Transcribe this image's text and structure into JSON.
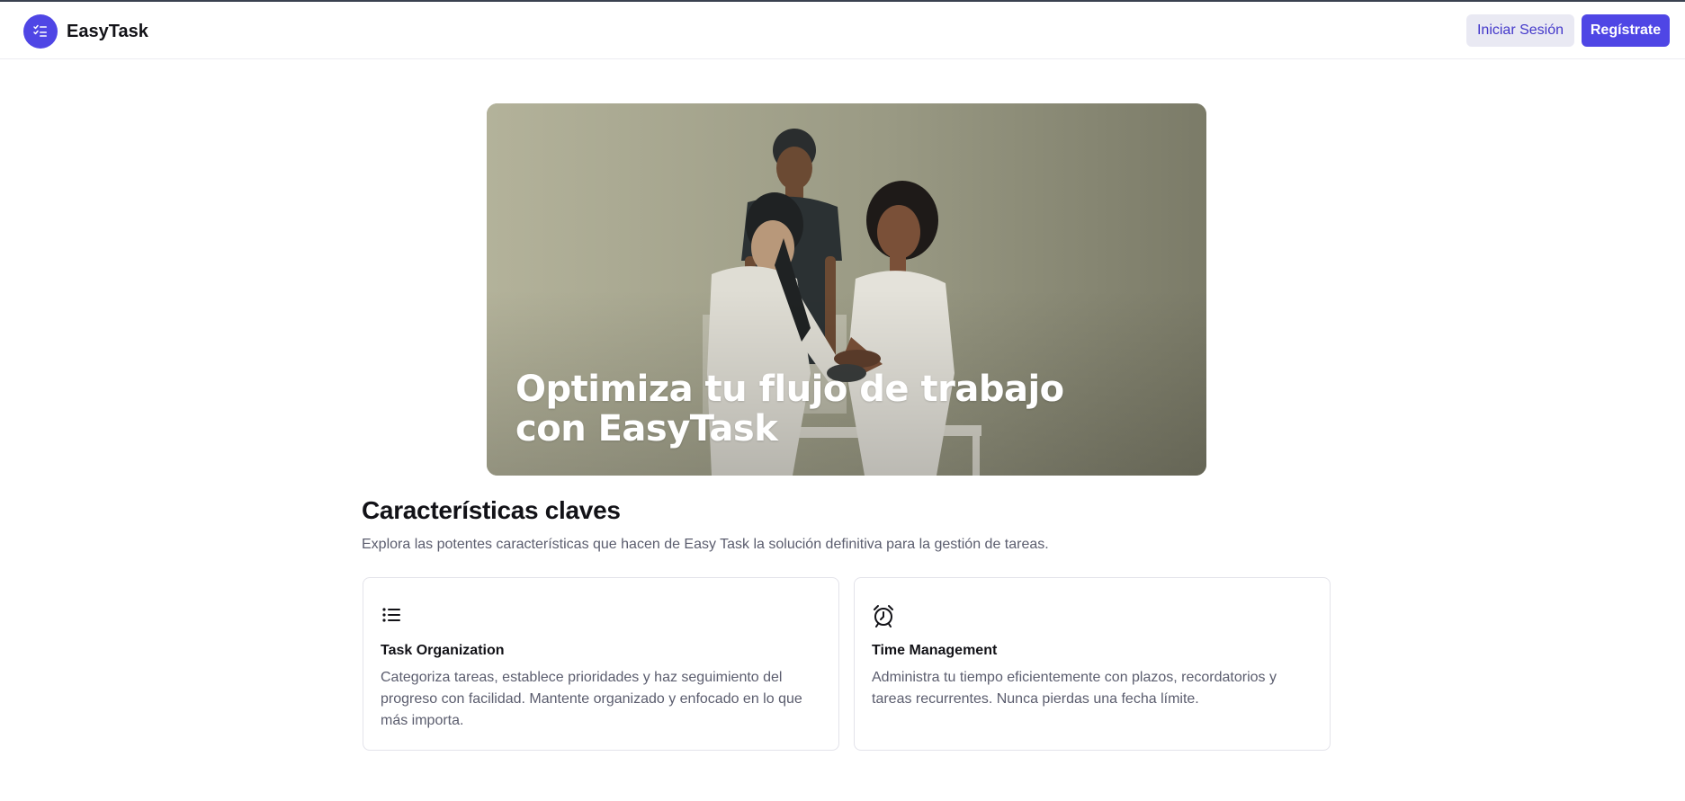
{
  "app": {
    "brand_name": "EasyTask",
    "accent_color": "#4f46e5"
  },
  "navbar": {
    "login_label": "Iniciar Sesión",
    "register_label": "Regístrate"
  },
  "hero": {
    "title": "Optimiza tu flujo de trabajo con EasyTask",
    "image_icon": "people-collaborating-illustration"
  },
  "features": {
    "title": "Características claves",
    "subtitle": "Explora las potentes características que hacen de Easy Task la solución definitiva para la gestión de tareas.",
    "cards": [
      {
        "icon": "list-icon",
        "title": "Task Organization",
        "description": "Categoriza tareas, establece prioridades y haz seguimiento del progreso con facilidad. Mantente organizado y enfocado en lo que más importa."
      },
      {
        "icon": "alarm-clock-icon",
        "title": "Time Management",
        "description": "Administra tu tiempo eficientemente con plazos, recordatorios y tareas recurrentes. Nunca pierdas una fecha límite."
      }
    ]
  }
}
